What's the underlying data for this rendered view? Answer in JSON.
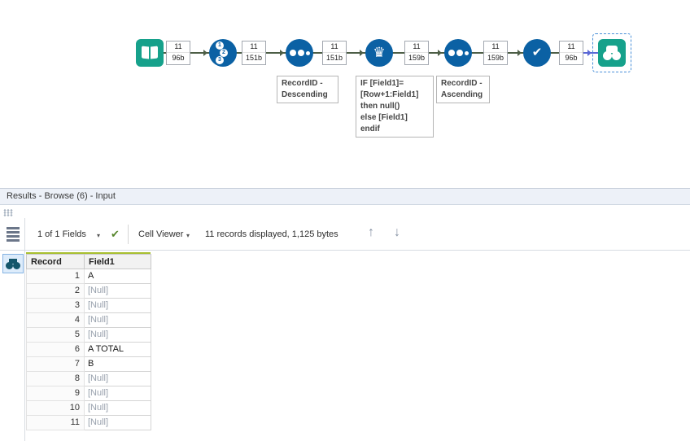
{
  "canvas": {
    "tools": {
      "input_data": {
        "icon": "book-icon"
      },
      "record_id": {
        "icon": "numbered-circles-icon",
        "digits": [
          "1",
          "2",
          "3"
        ]
      },
      "sort_descending": {
        "icon": "sort-dots-icon"
      },
      "multi_row_formula": {
        "icon": "crown-icon"
      },
      "sort_ascending": {
        "icon": "sort-dots-icon"
      },
      "check": {
        "icon": "checkmark-icon"
      },
      "browse": {
        "icon": "binoculars-icon",
        "selected": true
      }
    },
    "badges": [
      {
        "records": "11",
        "size": "96b"
      },
      {
        "records": "11",
        "size": "151b"
      },
      {
        "records": "11",
        "size": "151b"
      },
      {
        "records": "11",
        "size": "159b"
      },
      {
        "records": "11",
        "size": "159b"
      },
      {
        "records": "11",
        "size": "96b"
      }
    ],
    "annotations": [
      {
        "text": "RecordID -\nDescending"
      },
      {
        "text": "IF [Field1]=\n[Row+1:Field1]\nthen null()\nelse [Field1]\nendif"
      },
      {
        "text": "RecordID -\nAscending"
      }
    ],
    "colors": {
      "tool_teal": "#16a18b",
      "tool_blue": "#0b61a4",
      "connection": "#4d5e46",
      "connection_selected": "#5b68d6",
      "selection_dash": "#4a90d9"
    }
  },
  "results": {
    "title": "Results - Browse (6) - Input",
    "toolbar": {
      "fields_label": "1 of 1 Fields",
      "cell_viewer_label": "Cell Viewer",
      "status": "11 records displayed, 1,125 bytes"
    },
    "table": {
      "columns": [
        "Record",
        "Field1"
      ],
      "rows": [
        {
          "record": "1",
          "field1": "A",
          "is_null": false
        },
        {
          "record": "2",
          "field1": "[Null]",
          "is_null": true
        },
        {
          "record": "3",
          "field1": "[Null]",
          "is_null": true
        },
        {
          "record": "4",
          "field1": "[Null]",
          "is_null": true
        },
        {
          "record": "5",
          "field1": "[Null]",
          "is_null": true
        },
        {
          "record": "6",
          "field1": "A TOTAL",
          "is_null": false
        },
        {
          "record": "7",
          "field1": "B",
          "is_null": false
        },
        {
          "record": "8",
          "field1": "[Null]",
          "is_null": true
        },
        {
          "record": "9",
          "field1": "[Null]",
          "is_null": true
        },
        {
          "record": "10",
          "field1": "[Null]",
          "is_null": true
        },
        {
          "record": "11",
          "field1": "[Null]",
          "is_null": true
        }
      ],
      "null_color": "#98a1ad",
      "accent_line_color": "#a8bf2f"
    }
  }
}
